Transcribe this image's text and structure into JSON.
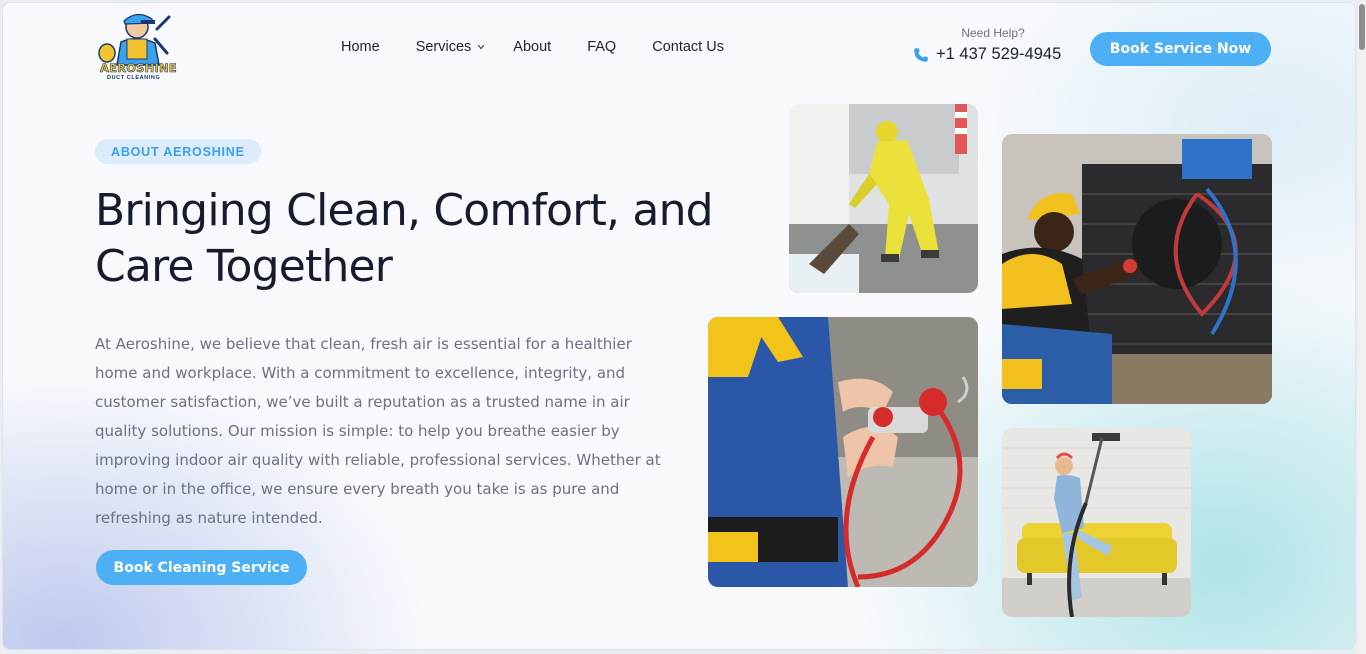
{
  "brand": {
    "name": "AEROSHINE",
    "tagline": "DUCT CLEANING",
    "colors": {
      "accent": "#4db0f5",
      "heading": "#161c2d",
      "body": "#6b7280",
      "badge_bg": "#dcecfa"
    }
  },
  "nav": {
    "items": [
      {
        "label": "Home"
      },
      {
        "label": "Services",
        "icon": "chevron-down-icon"
      },
      {
        "label": "About"
      },
      {
        "label": "FAQ"
      },
      {
        "label": "Contact Us"
      }
    ]
  },
  "help": {
    "label": "Need Help?",
    "phone": "+1 437 529-4945",
    "icon": "phone-icon"
  },
  "header_cta": {
    "label": "Book Service Now"
  },
  "hero": {
    "badge": "ABOUT AEROSHINE",
    "heading": "Bringing Clean, Comfort, and Care Together",
    "body": "At Aeroshine, we believe that clean, fresh air is essential for a healthier home and workplace. With a commitment to excellence, integrity, and customer satisfaction, we’ve built a reputation as a trusted name in air quality solutions. Our mission is simple: to help you breathe easier by improving indoor air quality with reliable, professional services. Whether at home or in the office, we ensure every breath you take is as pure and refreshing as nature intended.",
    "cta": "Book Cleaning Service"
  }
}
